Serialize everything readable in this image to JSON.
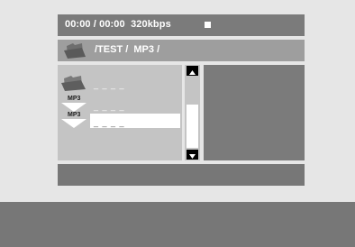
{
  "status": {
    "time": "00:00 / 00:00",
    "bitrate": "320kbps",
    "playback_state_icon": "stop-icon"
  },
  "path": {
    "folder_icon": "folder-icon",
    "text": "/TEST /  MP3 /"
  },
  "file_list": {
    "items": [
      {
        "icon": "folder-icon",
        "tag": "",
        "name": "_ _ _ _",
        "selected": false
      },
      {
        "icon": "mp3-file-icon",
        "tag": "MP3",
        "name": "_ _ _ _",
        "selected": false
      },
      {
        "icon": "mp3-file-icon",
        "tag": "MP3",
        "name": "_ _ _ _",
        "selected": true
      }
    ]
  },
  "scrollbar": {
    "up_icon": "arrow-up-icon",
    "down_icon": "arrow-down-icon"
  },
  "colors": {
    "background": "#e6e6e6",
    "bar_dark": "#7b7b7b",
    "path_bar": "#9e9e9e",
    "list_bg": "#c4c4c4",
    "highlight": "#ffffff"
  }
}
